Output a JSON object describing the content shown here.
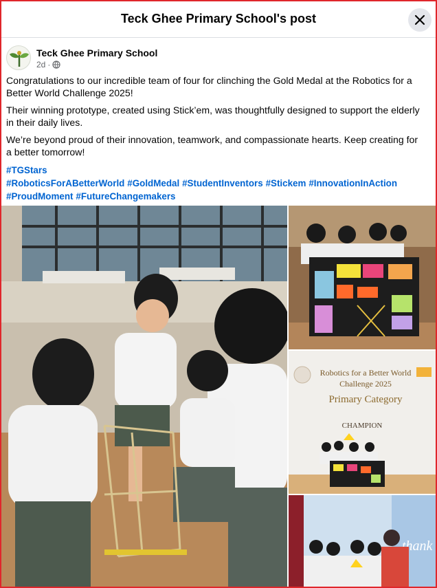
{
  "header": {
    "title": "Teck Ghee Primary School's post"
  },
  "author": {
    "name": "Teck Ghee Primary School",
    "time": "2d",
    "separator": "·",
    "privacy_icon": "globe-icon"
  },
  "post": {
    "paragraphs": [
      "Congratulations to our incredible team of four for clinching the Gold Medal at the Robotics for a Better World Challenge 2025!",
      "Their winning prototype, created using Stick’em, was thoughtfully designed to support the elderly in their daily lives.",
      "We’re beyond proud of their innovation, teamwork, and compassionate hearts. Keep creating for a better tomorrow!"
    ],
    "hashtags": [
      "#TGStars",
      "#RoboticsForABetterWorld",
      "#GoldMedal",
      "#StudentInventors",
      "#Stickem",
      "#InnovationInAction",
      "#ProudMoment",
      "#FutureChangemakers"
    ]
  },
  "photos": {
    "banner": {
      "line1": "Robotics for a Better World",
      "line2": "Challenge 2025",
      "line3": "Primary Category",
      "line4": "CHAMPION"
    },
    "thanks_text": "thank"
  },
  "icons": {
    "close": "close-icon",
    "globe": "globe-icon",
    "logo": "school-logo"
  }
}
